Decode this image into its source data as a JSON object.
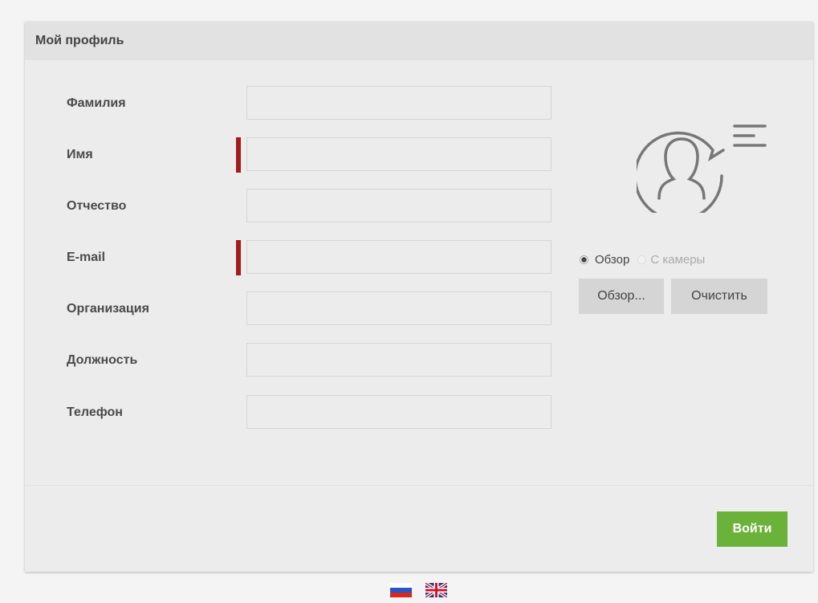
{
  "panel": {
    "title": "Мой профиль"
  },
  "form": {
    "fields": [
      {
        "label": "Фамилия",
        "value": "",
        "required": false
      },
      {
        "label": "Имя",
        "value": "",
        "required": true
      },
      {
        "label": "Отчество",
        "value": "",
        "required": false
      },
      {
        "label": "E-mail",
        "value": "",
        "required": true
      },
      {
        "label": "Организация",
        "value": "",
        "required": false
      },
      {
        "label": "Должность",
        "value": "",
        "required": false
      },
      {
        "label": "Телефон",
        "value": "",
        "required": false
      }
    ]
  },
  "photo": {
    "avatar_icon": "user-chat-icon",
    "source_options": [
      {
        "label": "Обзор",
        "selected": true
      },
      {
        "label": "С камеры",
        "selected": false
      }
    ],
    "browse_label": "Обзор...",
    "clear_label": "Очистить"
  },
  "footer": {
    "submit_label": "Войти"
  },
  "languages": [
    {
      "icon": "russia-flag-icon"
    },
    {
      "icon": "uk-flag-icon"
    }
  ],
  "colors": {
    "required_marker": "#a31b1b",
    "submit_button": "#6ab23a",
    "panel_background": "#ececec",
    "header_background": "#e2e2e2"
  }
}
